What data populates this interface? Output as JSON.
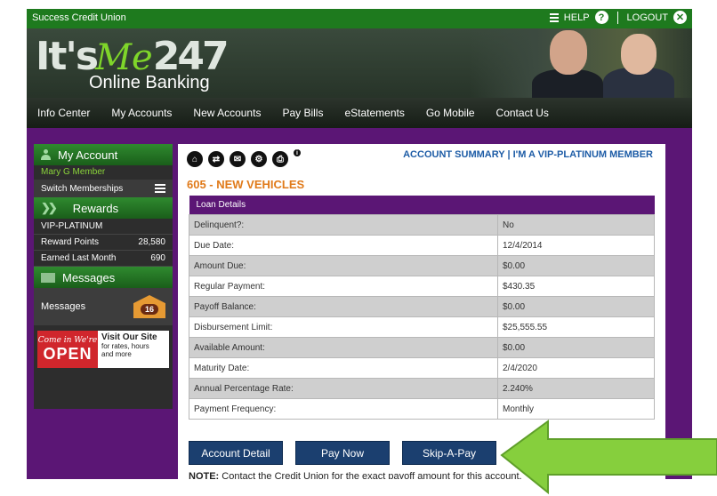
{
  "topbar": {
    "credit_union": "Success Credit Union",
    "help": "HELP",
    "logout": "LOGOUT",
    "help_icon": "?",
    "logout_icon": "✕"
  },
  "logo": {
    "its": "It's",
    "me": "Me",
    "num": "247",
    "subtitle": "Online Banking"
  },
  "nav": [
    "Info Center",
    "My Accounts",
    "New Accounts",
    "Pay Bills",
    "eStatements",
    "Go Mobile",
    "Contact Us"
  ],
  "sidebar": {
    "my_account": "My Account",
    "member_name": "Mary G Member",
    "switch": "Switch Memberships",
    "rewards": "Rewards",
    "tier": "VIP-PLATINUM",
    "reward_points_label": "Reward Points",
    "reward_points": "28,580",
    "earned_label": "Earned Last Month",
    "earned": "690",
    "messages_header": "Messages",
    "messages_label": "Messages",
    "messages_count": "16",
    "promo_come": "Come in We're",
    "promo_open": "OPEN",
    "promo_title": "Visit Our Site",
    "promo_sub1": "for rates, hours",
    "promo_sub2": "and more"
  },
  "main": {
    "summary": "ACCOUNT SUMMARY | I'M A VIP-PLATINUM MEMBER",
    "account_title": "605 - NEW VEHICLES",
    "table_header": "Loan Details",
    "rows": [
      {
        "label": "Delinquent?:",
        "value": "No"
      },
      {
        "label": "Due Date:",
        "value": "12/4/2014"
      },
      {
        "label": "Amount Due:",
        "value": "$0.00"
      },
      {
        "label": "Regular Payment:",
        "value": "$430.35"
      },
      {
        "label": "Payoff Balance:",
        "value": "$0.00"
      },
      {
        "label": "Disbursement Limit:",
        "value": "$25,555.55"
      },
      {
        "label": "Available Amount:",
        "value": "$0.00"
      },
      {
        "label": "Maturity Date:",
        "value": "2/4/2020"
      },
      {
        "label": "Annual Percentage Rate:",
        "value": "2.240%"
      },
      {
        "label": "Payment Frequency:",
        "value": "Monthly"
      }
    ],
    "buttons": {
      "account_detail": "Account Detail",
      "pay_now": "Pay Now",
      "skip_a_pay": "Skip-A-Pay"
    },
    "note_bold": "NOTE:",
    "note_text": " Contact the Credit Union for the exact payoff amount for this account."
  },
  "colors": {
    "purple": "#5b1675",
    "green": "#1e7a1e",
    "orange": "#e07a1a",
    "blue": "#1d5ca6",
    "arrow": "#86cf3d"
  }
}
